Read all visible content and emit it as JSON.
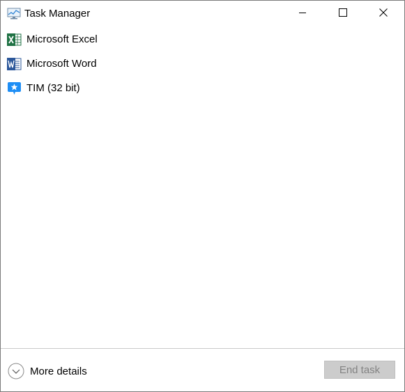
{
  "window": {
    "title": "Task Manager",
    "title_icon": "task-manager-icon",
    "controls": {
      "minimize_icon": "minimize-icon",
      "maximize_icon": "maximize-icon",
      "close_icon": "close-icon"
    }
  },
  "apps": [
    {
      "label": "Microsoft Excel",
      "icon": "excel-icon",
      "color": "#1f7244"
    },
    {
      "label": "Microsoft Word",
      "icon": "word-icon",
      "color": "#2b579a"
    },
    {
      "label": "TIM (32 bit)",
      "icon": "tim-icon",
      "color": "#1e8ef5"
    }
  ],
  "footer": {
    "more_details_label": "More details",
    "more_details_icon": "chevron-down-circle-icon",
    "end_task_label": "End task",
    "end_task_enabled": false
  }
}
